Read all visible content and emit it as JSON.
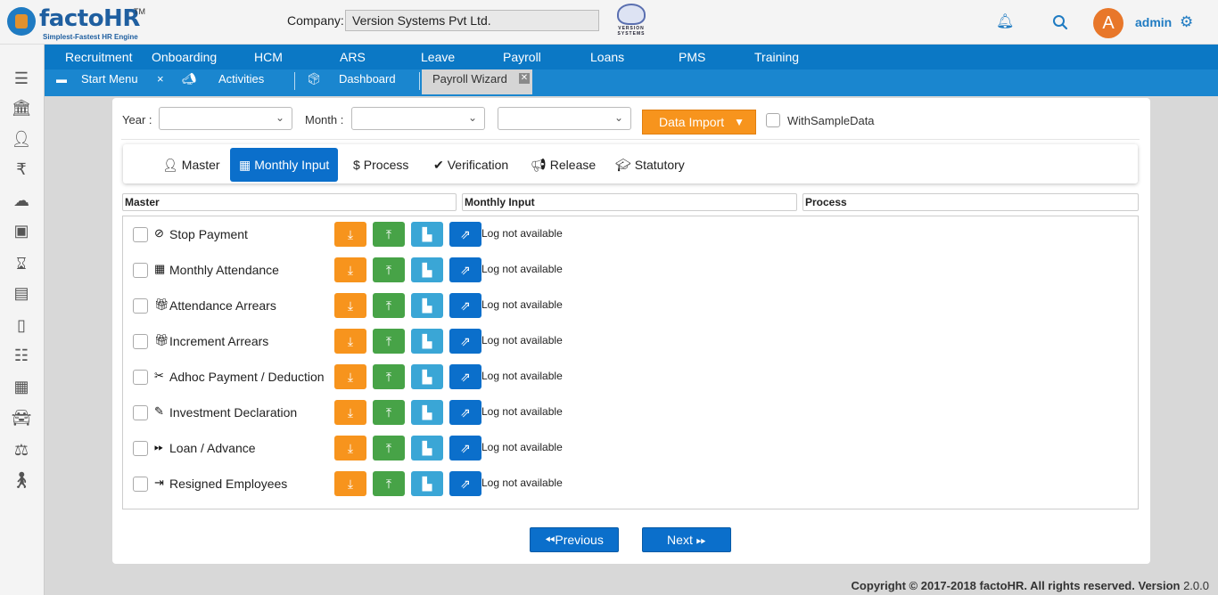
{
  "header": {
    "logo_text": "factoHR",
    "logo_tm": "TM",
    "logo_tagline": "Simplest-Fastest HR Engine",
    "company_label": "Company:",
    "company_value": "Version Systems Pvt Ltd.",
    "vs_logo_text": "VERSION SYSTEMS",
    "avatar_letter": "A",
    "user_name": "admin"
  },
  "nav": {
    "items": [
      "Recruitment",
      "Onboarding",
      "HCM",
      "ARS",
      "Leave",
      "Payroll",
      "Loans",
      "PMS",
      "Training"
    ]
  },
  "tabs": {
    "start_menu": "Start Menu",
    "activities": "Activities",
    "dashboard": "Dashboard",
    "payroll_wizard": "Payroll Wizard",
    "close_glyph": "×",
    "box_close_glyph": "✕"
  },
  "filters": {
    "year_label": "Year :",
    "year_value": "",
    "month_label": "Month :",
    "month_value": "",
    "third_value": "",
    "data_import_label": "Data Import",
    "with_sample_label": "WithSampleData"
  },
  "wizard": {
    "steps": [
      "Master",
      "Monthly Input",
      "Process",
      "Verification",
      "Release",
      "Statutory"
    ],
    "active": "Monthly Input"
  },
  "columns": {
    "master": "Master",
    "monthly_input": "Monthly Input",
    "process": "Process"
  },
  "rows": [
    {
      "label": "Stop Payment",
      "log": "Log not available",
      "icon": "ban-icon"
    },
    {
      "label": "Monthly Attendance",
      "log": "Log not available",
      "icon": "calendar-icon"
    },
    {
      "label": "Attendance Arrears",
      "log": "Log not available",
      "icon": "gift-icon"
    },
    {
      "label": "Increment Arrears",
      "log": "Log not available",
      "icon": "gift-icon"
    },
    {
      "label": "Adhoc Payment / Deduction",
      "log": "Log not available",
      "icon": "scissors-icon"
    },
    {
      "label": "Investment Declaration",
      "log": "Log not available",
      "icon": "pencil-icon"
    },
    {
      "label": "Loan / Advance",
      "log": "Log not available",
      "icon": "fast-forward-icon"
    },
    {
      "label": "Resigned Employees",
      "log": "Log not available",
      "icon": "sign-out-icon"
    }
  ],
  "buttons": {
    "previous": "Previous",
    "next": "Next"
  },
  "footer": {
    "copyright": "Copyright © 2017-2018 factoHR.  All rights reserved.",
    "version_label": "Version",
    "version_value": "2.0.0"
  },
  "colors": {
    "primary": "#0b78c5",
    "orange": "#f7941d",
    "green": "#47a347",
    "cyan": "#3aa6d6",
    "blue": "#0b6fcb"
  }
}
